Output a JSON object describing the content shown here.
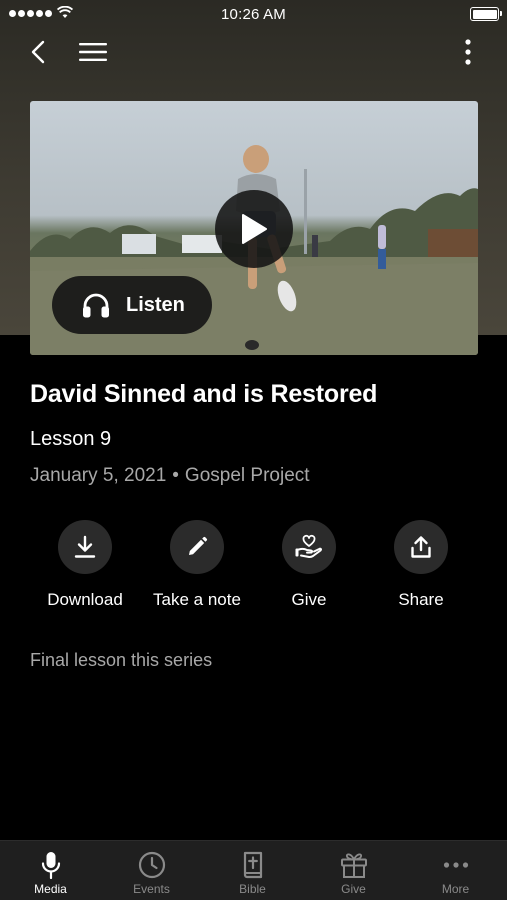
{
  "status_bar": {
    "time": "10:26 AM"
  },
  "nav": {
    "back_icon": "chevron-left-icon",
    "menu_icon": "hamburger-menu-icon",
    "more_icon": "vertical-ellipsis-icon"
  },
  "media": {
    "play_icon": "play-icon",
    "listen_label": "Listen",
    "listen_icon": "headphones-icon"
  },
  "content": {
    "title": "David Sinned and is Restored",
    "subtitle": "Lesson 9",
    "date": "January 5, 2021",
    "separator": "•",
    "series": "Gospel Project",
    "series_note": "Final lesson this series"
  },
  "actions": [
    {
      "label": "Download",
      "icon": "download-icon"
    },
    {
      "label": "Take a note",
      "icon": "pencil-icon"
    },
    {
      "label": "Give",
      "icon": "give-heart-hand-icon"
    },
    {
      "label": "Share",
      "icon": "share-icon"
    }
  ],
  "tab_bar": {
    "active": "Media",
    "tabs": [
      {
        "label": "Media",
        "icon": "microphone-icon"
      },
      {
        "label": "Events",
        "icon": "clock-icon"
      },
      {
        "label": "Bible",
        "icon": "bible-icon"
      },
      {
        "label": "Give",
        "icon": "gift-icon"
      },
      {
        "label": "More",
        "icon": "horizontal-ellipsis-icon"
      }
    ]
  },
  "colors": {
    "background": "#000000",
    "hero_background": "#3e3b32",
    "secondary_text": "#a8a8a8",
    "action_circle": "#2b2b2b",
    "tab_bar": "#1f1f1f"
  }
}
